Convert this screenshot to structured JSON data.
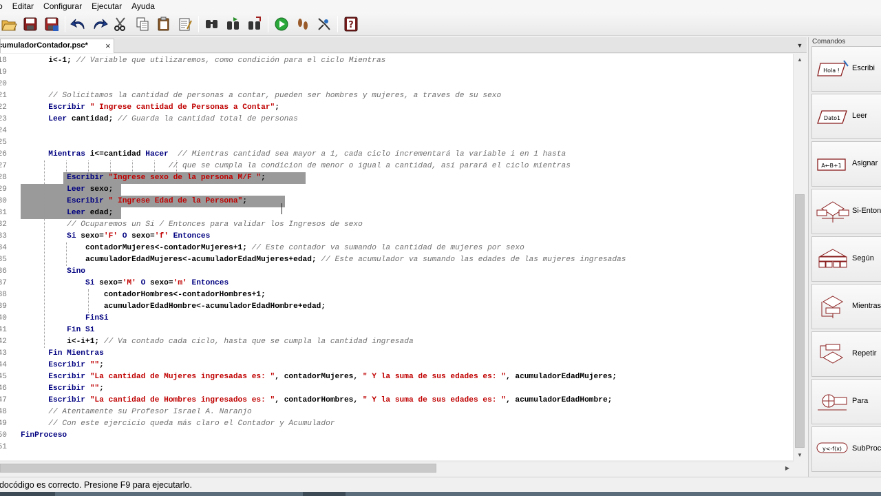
{
  "menu": [
    "o",
    "Editar",
    "Configurar",
    "Ejecutar",
    "Ayuda"
  ],
  "toolbar": {
    "buttons": [
      "open-icon",
      "save-icon",
      "save-as-icon",
      "undo-icon",
      "redo-icon",
      "cut-icon",
      "copy-icon",
      "paste-icon",
      "edit-icon",
      "search-icon",
      "search-next-icon",
      "replace-icon",
      "run-icon",
      "step-icon",
      "debug-icon",
      "help-icon"
    ]
  },
  "tab": {
    "label": "cumuladorContador.psc*",
    "close": "×"
  },
  "editor": {
    "lines": [
      {
        "n": "18",
        "tokens": [
          [
            "var",
            "      i<-1;"
          ],
          [
            "cm",
            " // Variable que utilizaremos, como condición para el ciclo Mientras"
          ]
        ]
      },
      {
        "n": "19",
        "tokens": []
      },
      {
        "n": "20",
        "tokens": []
      },
      {
        "n": "21",
        "tokens": [
          [
            "cm",
            "      // Solicitamos la cantidad de personas a contar, pueden ser hombres y mujeres, a traves de su sexo"
          ]
        ]
      },
      {
        "n": "22",
        "tokens": [
          [
            "kw",
            "      Escribir"
          ],
          [
            "str",
            " \" Ingrese cantidad de Personas a Contar\""
          ],
          [
            "var",
            ";"
          ]
        ]
      },
      {
        "n": "23",
        "tokens": [
          [
            "kw",
            "      Leer"
          ],
          [
            "var",
            " cantidad;"
          ],
          [
            "cm",
            " // Guarda la cantidad total de personas"
          ]
        ]
      },
      {
        "n": "24",
        "tokens": []
      },
      {
        "n": "25",
        "tokens": []
      },
      {
        "n": "26",
        "tokens": [
          [
            "kw",
            "      Mientras"
          ],
          [
            "var",
            " i<=cantidad"
          ],
          [
            "kw",
            " Hacer"
          ],
          [
            "cm",
            "  // Mientras cantidad sea mayor a 1, cada ciclo incrementará la variable i en 1 hasta"
          ]
        ]
      },
      {
        "n": "27",
        "tokens": [
          [
            "cm",
            "                                // que se cumpla la condicion de menor o igual a cantidad, así parará el ciclo mientras"
          ]
        ]
      },
      {
        "n": "28",
        "tokens": [
          [
            "kw",
            "          Escribir"
          ],
          [
            "str",
            " \"Ingrese sexo de la persona M/F \""
          ],
          [
            "var",
            ";"
          ]
        ]
      },
      {
        "n": "29",
        "tokens": [
          [
            "kw",
            "          Leer"
          ],
          [
            "var",
            " sexo;"
          ]
        ]
      },
      {
        "n": "30",
        "tokens": [
          [
            "kw",
            "          Escribir"
          ],
          [
            "str",
            " \" Ingrese Edad de la Persona\""
          ],
          [
            "var",
            ";"
          ]
        ]
      },
      {
        "n": "31",
        "tokens": [
          [
            "kw",
            "          Leer"
          ],
          [
            "var",
            " edad;"
          ]
        ]
      },
      {
        "n": "32",
        "tokens": [
          [
            "cm",
            "          // Ocuparemos un Si / Entonces para validar los Ingresos de sexo"
          ]
        ]
      },
      {
        "n": "33",
        "tokens": [
          [
            "kw",
            "          Si"
          ],
          [
            "var",
            " sexo="
          ],
          [
            "str",
            "'F'"
          ],
          [
            "kw",
            " O"
          ],
          [
            "var",
            " sexo="
          ],
          [
            "str",
            "'f'"
          ],
          [
            "kw",
            " Entonces"
          ]
        ]
      },
      {
        "n": "34",
        "tokens": [
          [
            "var",
            "              contadorMujeres<-contadorMujeres+1;"
          ],
          [
            "cm",
            " // Este contador va sumando la cantidad de mujeres por sexo"
          ]
        ]
      },
      {
        "n": "35",
        "tokens": [
          [
            "var",
            "              acumuladorEdadMujeres<-acumuladorEdadMujeres+edad;"
          ],
          [
            "cm",
            " // Este acumulador va sumando las edades de las mujeres ingresadas"
          ]
        ]
      },
      {
        "n": "36",
        "tokens": [
          [
            "kw",
            "          Sino"
          ]
        ]
      },
      {
        "n": "37",
        "tokens": [
          [
            "kw",
            "              Si"
          ],
          [
            "var",
            " sexo="
          ],
          [
            "str",
            "'M'"
          ],
          [
            "kw",
            " O"
          ],
          [
            "var",
            " sexo="
          ],
          [
            "str",
            "'m'"
          ],
          [
            "kw",
            " Entonces"
          ]
        ]
      },
      {
        "n": "38",
        "tokens": [
          [
            "var",
            "                  contadorHombres<-contadorHombres+1;"
          ]
        ]
      },
      {
        "n": "39",
        "tokens": [
          [
            "var",
            "                  acumuladorEdadHombre<-acumuladorEdadHombre+edad;"
          ]
        ]
      },
      {
        "n": "40",
        "tokens": [
          [
            "kw",
            "              FinSi"
          ]
        ]
      },
      {
        "n": "41",
        "tokens": [
          [
            "kw",
            "          Fin Si"
          ]
        ]
      },
      {
        "n": "42",
        "tokens": [
          [
            "var",
            "          i<-i+1;"
          ],
          [
            "cm",
            " // Va contado cada ciclo, hasta que se cumpla la cantidad ingresada"
          ]
        ]
      },
      {
        "n": "43",
        "tokens": [
          [
            "kw",
            "      Fin Mientras"
          ]
        ]
      },
      {
        "n": "44",
        "tokens": [
          [
            "kw",
            "      Escribir"
          ],
          [
            "str",
            " \"\""
          ],
          [
            "var",
            ";"
          ]
        ]
      },
      {
        "n": "45",
        "tokens": [
          [
            "kw",
            "      Escribir"
          ],
          [
            "str",
            " \"La cantidad de Mujeres ingresadas es: \""
          ],
          [
            "var",
            ", contadorMujeres, "
          ],
          [
            "str",
            "\" Y la suma de sus edades es: \""
          ],
          [
            "var",
            ", acumuladorEdadMujeres;"
          ]
        ]
      },
      {
        "n": "46",
        "tokens": [
          [
            "kw",
            "      Escribir"
          ],
          [
            "str",
            " \"\""
          ],
          [
            "var",
            ";"
          ]
        ]
      },
      {
        "n": "47",
        "tokens": [
          [
            "kw",
            "      Escribir"
          ],
          [
            "str",
            " \"La cantidad de Hombres ingresados es: \""
          ],
          [
            "var",
            ", contadorHombres, "
          ],
          [
            "str",
            "\" Y la suma de sus edades es: \""
          ],
          [
            "var",
            ", acumuladorEdadHombre;"
          ]
        ]
      },
      {
        "n": "48",
        "tokens": [
          [
            "cm",
            "      // Atentamente su Profesor Israel A. Naranjo"
          ]
        ]
      },
      {
        "n": "49",
        "tokens": [
          [
            "cm",
            "      // Con este ejercicio queda más claro el Contador y Acumulador"
          ]
        ]
      },
      {
        "n": "50",
        "tokens": [
          [
            "kw",
            "FinProceso"
          ]
        ]
      },
      {
        "n": "51",
        "tokens": []
      }
    ]
  },
  "status": {
    "text": "udocódigo es correcto. Presione F9 para ejecutarlo."
  },
  "panel": {
    "title": "Comandos",
    "commands": [
      {
        "label": "Escribi",
        "icon": "escribir-icon",
        "icon_text": "Hola !"
      },
      {
        "label": "Leer",
        "icon": "leer-icon",
        "icon_text": "Dato1"
      },
      {
        "label": "Asignar",
        "icon": "asignar-icon",
        "icon_text": "A←B+1"
      },
      {
        "label": "Si-Enton",
        "icon": "si-entonces-icon",
        "icon_text": ""
      },
      {
        "label": "Según",
        "icon": "segun-icon",
        "icon_text": ""
      },
      {
        "label": "Mientras",
        "icon": "mientras-icon",
        "icon_text": ""
      },
      {
        "label": "Repetir",
        "icon": "repetir-icon",
        "icon_text": ""
      },
      {
        "label": "Para",
        "icon": "para-icon",
        "icon_text": ""
      },
      {
        "label": "SubProce",
        "icon": "subproceso-icon",
        "icon_text": "y<-f(x)"
      }
    ]
  }
}
